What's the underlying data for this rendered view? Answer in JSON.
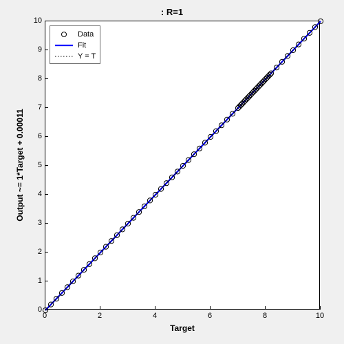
{
  "chart_data": {
    "type": "scatter",
    "title": ": R=1",
    "xlabel": "Target",
    "ylabel": "Output ~= 1*Target + 0.00011",
    "xlim": [
      0,
      10
    ],
    "ylim": [
      0,
      10
    ],
    "xticks": [
      0,
      2,
      4,
      6,
      8,
      10
    ],
    "yticks": [
      0,
      1,
      2,
      3,
      4,
      5,
      6,
      7,
      8,
      9,
      10
    ],
    "legend": {
      "position": "top-left",
      "entries": [
        "Data",
        "Fit",
        "Y = T"
      ]
    },
    "series": [
      {
        "name": "Data",
        "style": "open-circle",
        "color": "#000000",
        "x": [
          0.0,
          0.2,
          0.4,
          0.6,
          0.8,
          1.0,
          1.2,
          1.4,
          1.6,
          1.8,
          2.0,
          2.2,
          2.4,
          2.6,
          2.8,
          3.0,
          3.2,
          3.4,
          3.6,
          3.8,
          4.0,
          4.2,
          4.4,
          4.6,
          4.8,
          5.0,
          5.2,
          5.4,
          5.6,
          5.8,
          6.0,
          6.2,
          6.4,
          6.6,
          6.8,
          7.0,
          7.05,
          7.1,
          7.15,
          7.2,
          7.25,
          7.3,
          7.35,
          7.4,
          7.45,
          7.5,
          7.55,
          7.6,
          7.65,
          7.7,
          7.75,
          7.8,
          7.85,
          7.9,
          7.95,
          8.0,
          8.05,
          8.1,
          8.15,
          8.2,
          8.4,
          8.6,
          8.8,
          9.0,
          9.2,
          9.4,
          9.6,
          9.8,
          10.0
        ],
        "y": [
          0.0,
          0.2,
          0.4,
          0.6,
          0.8,
          1.0,
          1.2,
          1.4,
          1.6,
          1.8,
          2.0,
          2.2,
          2.4,
          2.6,
          2.8,
          3.0,
          3.2,
          3.4,
          3.6,
          3.8,
          4.0,
          4.2,
          4.4,
          4.6,
          4.8,
          5.0,
          5.2,
          5.4,
          5.6,
          5.8,
          6.0,
          6.2,
          6.4,
          6.6,
          6.8,
          7.0,
          7.05,
          7.1,
          7.15,
          7.2,
          7.25,
          7.3,
          7.35,
          7.4,
          7.45,
          7.5,
          7.55,
          7.6,
          7.65,
          7.7,
          7.75,
          7.8,
          7.85,
          7.9,
          7.95,
          8.0,
          8.05,
          8.1,
          8.15,
          8.2,
          8.4,
          8.6,
          8.8,
          9.0,
          9.2,
          9.4,
          9.6,
          9.8,
          10.0
        ]
      },
      {
        "name": "Fit",
        "style": "solid-line",
        "color": "#0000ff",
        "width": 2.2,
        "x": [
          0,
          10
        ],
        "y": [
          0.00011,
          10.00011
        ]
      },
      {
        "name": "Y = T",
        "style": "dotted-line",
        "color": "#000000",
        "width": 1,
        "x": [
          0,
          10
        ],
        "y": [
          0,
          10
        ]
      }
    ]
  },
  "colors": {
    "figure_bg": "#f0f0f0",
    "axes_bg": "#ffffff",
    "fit": "#0000ff",
    "data": "#000000"
  }
}
